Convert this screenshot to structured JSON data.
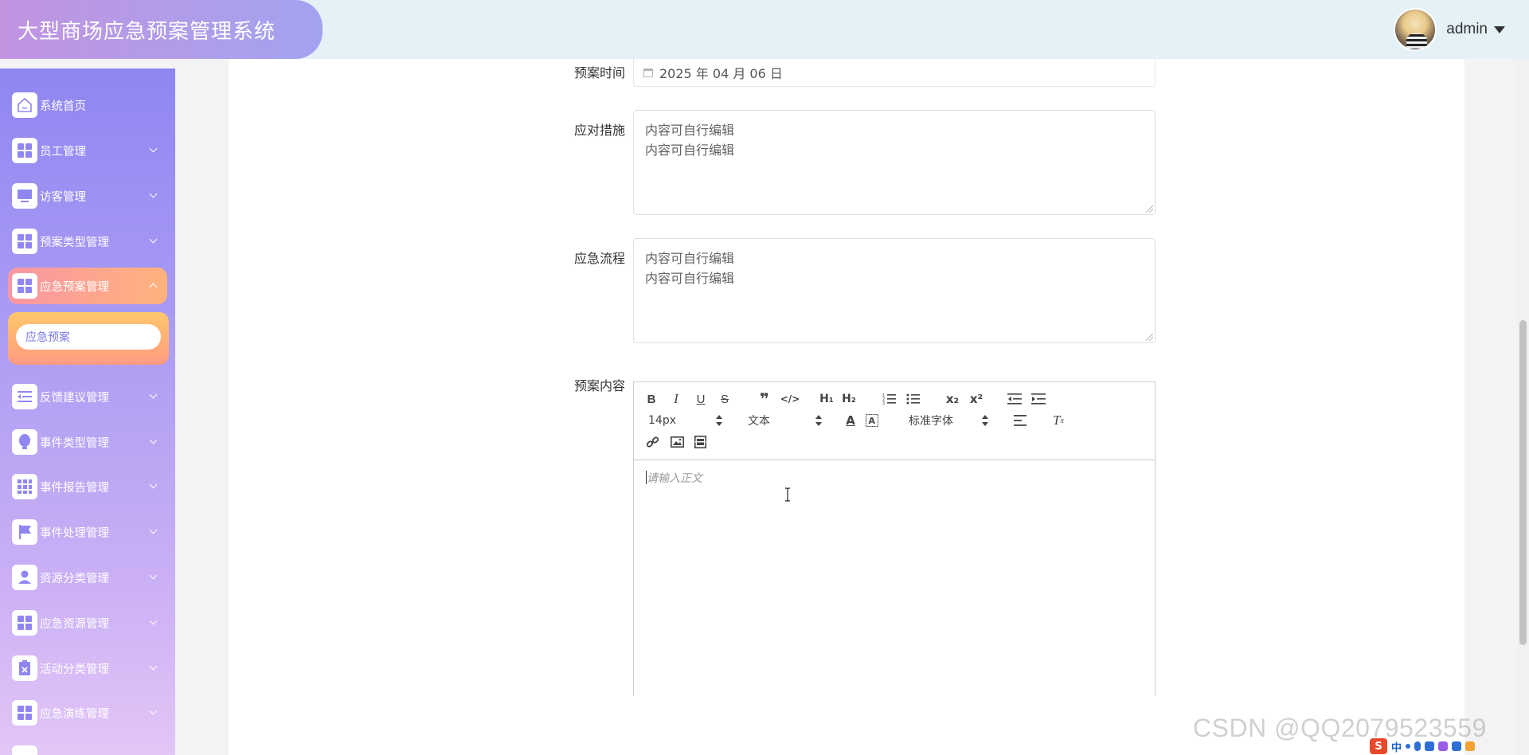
{
  "header": {
    "title": "大型商场应急预案管理系统",
    "username": "admin"
  },
  "sidebar": {
    "items": [
      {
        "label": "系统首页",
        "icon": "home-icon",
        "expanded": false,
        "active": false,
        "has_chevron": false
      },
      {
        "label": "员工管理",
        "icon": "grid-icon",
        "active": false,
        "has_chevron": true
      },
      {
        "label": "访客管理",
        "icon": "monitor-icon",
        "active": false,
        "has_chevron": true
      },
      {
        "label": "预案类型管理",
        "icon": "grid-icon",
        "active": false,
        "has_chevron": true
      },
      {
        "label": "应急预案管理",
        "icon": "grid-icon",
        "active": true,
        "has_chevron": true
      },
      {
        "label": "反馈建议管理",
        "icon": "list-indent-icon",
        "active": false,
        "has_chevron": true
      },
      {
        "label": "事件类型管理",
        "icon": "bulb-icon",
        "active": false,
        "has_chevron": true
      },
      {
        "label": "事件报告管理",
        "icon": "apps-icon",
        "active": false,
        "has_chevron": true
      },
      {
        "label": "事件处理管理",
        "icon": "flag-icon",
        "active": false,
        "has_chevron": true
      },
      {
        "label": "资源分类管理",
        "icon": "user-icon",
        "active": false,
        "has_chevron": true
      },
      {
        "label": "应急资源管理",
        "icon": "grid-icon",
        "active": false,
        "has_chevron": true
      },
      {
        "label": "活动分类管理",
        "icon": "clipboard-icon",
        "active": false,
        "has_chevron": true
      },
      {
        "label": "应急演练管理",
        "icon": "grid-icon",
        "active": false,
        "has_chevron": true
      }
    ],
    "submenu": {
      "label": "应急预案"
    }
  },
  "form": {
    "date": {
      "label": "预案时间",
      "value": "2025 年 04 月 06 日"
    },
    "measures": {
      "label": "应对措施",
      "lines": [
        "内容可自行编辑",
        "内容可自行编辑"
      ]
    },
    "process": {
      "label": "应急流程",
      "lines": [
        "内容可自行编辑",
        "内容可自行编辑"
      ]
    },
    "content": {
      "label": "预案内容",
      "placeholder": "请输入正文",
      "font_size": "14px",
      "header_select": "文本",
      "font_family": "标准字体"
    }
  },
  "watermark": "CSDN @QQ2079523559",
  "tray": {
    "ime_letter": "S",
    "ime_mode": "中"
  },
  "colors": {
    "sidebar_top": "#8f86f2",
    "sidebar_bottom": "#e2c6f7",
    "active_item": "#f996a4",
    "submenu_text": "#7a78e8"
  }
}
